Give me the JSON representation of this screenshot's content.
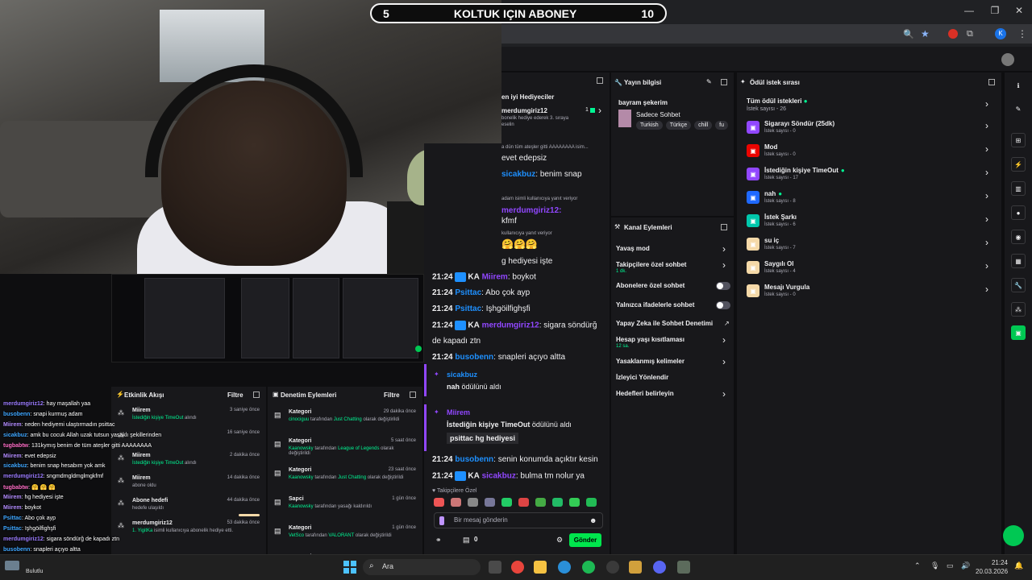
{
  "banner": {
    "left": "5",
    "title": "KOLTUK IÇIN ABONEY",
    "right": "10"
  },
  "browser": {
    "avatar_letter": "K"
  },
  "top_gifters": {
    "title": "en iyi Hediyeciler",
    "name": "merdumgiriz12",
    "count": "1",
    "desc1": "bonelik hediye ederek 3. sıraya",
    "desc2": "eselin"
  },
  "chat": {
    "lines_top": [
      {
        "text": "a dün tüm ateşler gitti AAAAAAAA isim...",
        "kind": "reply"
      },
      {
        "text": "evet edepsiz",
        "kind": "msg"
      },
      {
        "user": "sicakbuz",
        "text": "benim snap",
        "kind": "userline"
      },
      {
        "text": "adam isimli kullanıcıya yanıt veriyor",
        "kind": "reply"
      },
      {
        "user": "merdumgiriz12:",
        "text": "",
        "kind": "userline"
      },
      {
        "text": "kfmf",
        "kind": "msg"
      },
      {
        "text": "kullanıcıya yanıt veriyor",
        "kind": "reply"
      },
      {
        "text": "🤗🤗🤗",
        "kind": "msg"
      },
      {
        "text": "g hediyesi işte",
        "kind": "msg"
      }
    ],
    "lines": [
      {
        "time": "21:24",
        "badge": "KA",
        "user": "Miirem",
        "color": "#9147ff",
        "text": "boykot"
      },
      {
        "time": "21:24",
        "badge": "",
        "user": "Psittac",
        "color": "#1e90ff",
        "text": "Abo çok ayp"
      },
      {
        "time": "21:24",
        "badge": "",
        "user": "Psittac",
        "color": "#1e90ff",
        "text": "Işhgöilfighşfi"
      },
      {
        "time": "21:24",
        "badge": "KA",
        "user": "merdumgiriz12",
        "color": "#9147ff",
        "text": "sigara söndürğ"
      },
      {
        "time": "",
        "badge": "",
        "user": "",
        "color": "",
        "text": "de kapadı ztn"
      },
      {
        "time": "21:24",
        "badge": "",
        "user": "busobenn",
        "color": "#1e90ff",
        "text": "snapleri açıyo altta"
      }
    ],
    "redeem1": {
      "user": "sicakbuz",
      "reward": "nah",
      "suffix": "ödülünü aldı"
    },
    "redeem2": {
      "user": "Miirem",
      "reward": "İstediğin kişiye TimeOut",
      "suffix": "ödülünü aldı",
      "input": "psittac hg hediyesi"
    },
    "lines_after": [
      {
        "time": "21:24",
        "badge": "",
        "user": "busobenn",
        "color": "#1e90ff",
        "text": "senin konumda açıktır kesin"
      },
      {
        "time": "21:24",
        "badge": "KA",
        "user": "sicakbuz",
        "color": "#9147ff",
        "text": "bulma tm nolur ya"
      }
    ],
    "followers_only": "Takipçilere Özel",
    "input_placeholder": "Bir mesaj gönderin",
    "points": "0",
    "send": "Gönder"
  },
  "stream_info": {
    "title": "Yayın bilgisi",
    "stream_title": "bayram şekerim",
    "category": "Sadece Sohbet",
    "tags": [
      "Turkish",
      "Türkçe",
      "chill",
      "fu"
    ]
  },
  "channel_actions": {
    "title": "Kanal Eylemleri",
    "items": [
      {
        "label": "Yavaş mod",
        "sub": "",
        "control": "chevron"
      },
      {
        "label": "Takipçilere özel sohbet",
        "sub": "1 dk.",
        "control": "chevron"
      },
      {
        "label": "Abonelere özel sohbet",
        "sub": "",
        "control": "toggle"
      },
      {
        "label": "Yalnızca ifadelerle sohbet",
        "sub": "",
        "control": "toggle"
      },
      {
        "label": "Yapay Zeka ile Sohbet Denetimi",
        "sub": "",
        "control": "external"
      },
      {
        "label": "Hesap yaşı kısıtlaması",
        "sub": "12 sa.",
        "control": "chevron"
      },
      {
        "label": "Yasaklanmış kelimeler",
        "sub": "",
        "control": "chevron"
      },
      {
        "label": "İzleyici Yönlendir",
        "sub": "",
        "control": "none"
      },
      {
        "label": "Hedefleri belirleyin",
        "sub": "",
        "control": "chevron"
      }
    ]
  },
  "rewards": {
    "title": "Ödül istek sırası",
    "all": {
      "label": "Tüm ödül istekleri",
      "count": "İstek sayısı - 26"
    },
    "items": [
      {
        "label": "Sigarayı Söndür (25dk)",
        "count": "İstek sayısı - 0",
        "color": "#9147ff",
        "dot": false
      },
      {
        "label": "Mod",
        "count": "İstek sayısı - 0",
        "color": "#eb0400",
        "dot": false
      },
      {
        "label": "İstediğin kişiye TimeOut",
        "count": "İstek sayısı - 17",
        "color": "#9147ff",
        "dot": true
      },
      {
        "label": "nah",
        "count": "İstek sayısı - 8",
        "color": "#1f69ff",
        "dot": true
      },
      {
        "label": "İstek Şarkı",
        "count": "İstek sayısı - 6",
        "color": "#00c7ac",
        "dot": false
      },
      {
        "label": "su iç",
        "count": "İstek sayısı - 7",
        "color": "#f5d9a8",
        "dot": false
      },
      {
        "label": "Saygılı Ol",
        "count": "İstek sayısı - 4",
        "color": "#f5d9a8",
        "dot": false
      },
      {
        "label": "Mesajı Vurgula",
        "count": "İstek sayısı - 0",
        "color": "#f5d9a8",
        "dot": false
      }
    ]
  },
  "activity": {
    "title": "Etkinlik Akışı",
    "filter": "Filtre",
    "items": [
      {
        "user": "Miirem",
        "text": "İstediğin kişiye TimeOut",
        "suffix": "alındı",
        "time": "3 saniye önce"
      },
      {
        "user": "",
        "text": "",
        "suffix": "",
        "time": "16 saniye önce"
      },
      {
        "user": "Miirem",
        "text": "İstediğin kişiye TimeOut",
        "suffix": "alındı",
        "time": "2 dakika önce"
      },
      {
        "user": "Miirem",
        "text": "",
        "suffix": "abone oldu",
        "time": "14 dakika önce"
      },
      {
        "user": "Abone hedefi",
        "text": "",
        "suffix": "hedefe ulaşıldı",
        "time": "44 dakika önce"
      },
      {
        "user": "merdumgiriz12",
        "text": "1. YigitKa",
        "suffix": "isimli kullanıcıya abonelik hediye etti.",
        "time": "53 dakika önce"
      }
    ]
  },
  "moderation": {
    "title": "Denetim Eylemleri",
    "filter": "Filtre",
    "items": [
      {
        "title": "Kategori",
        "user": "cinociguu",
        "mid": "tarafından",
        "target": "Just Chatting",
        "end": "olarak değiştirildi",
        "time": "29 dakika önce"
      },
      {
        "title": "Kategori",
        "user": "Kaanowsky",
        "mid": "tarafından",
        "target": "League of Legends",
        "end": "olarak değiştirildi",
        "time": "5 saat önce"
      },
      {
        "title": "Kategori",
        "user": "Kaanowsky",
        "mid": "tarafından",
        "target": "Just Chatting",
        "end": "olarak değiştirildi",
        "time": "23 saat önce"
      },
      {
        "title": "Sapci",
        "user": "Kaanowsky",
        "mid": "tarafından yasağı kaldırıldı",
        "target": "",
        "end": "",
        "time": "1 gün önce"
      },
      {
        "title": "Kategori",
        "user": "VetSco",
        "mid": "tarafından",
        "target": "VALORANT",
        "end": "olarak değiştirildi",
        "time": "1 gün önce"
      },
      {
        "title": "Kategori",
        "user": "",
        "mid": "",
        "target": "",
        "end": "",
        "time": ""
      }
    ]
  },
  "overlay_chat": [
    {
      "user": "merdumgiriz12",
      "ucolor": "#9b7bff",
      "text": ": hay maşallah yaa"
    },
    {
      "user": "busobenn",
      "ucolor": "#3ea6ff",
      "text": ": snapi kurmuş adam"
    },
    {
      "user": "Miirem",
      "ucolor": "#b38cff",
      "text": ": neden hediyemi ulaştırmadın psittac"
    },
    {
      "user": "sicakbuz",
      "ucolor": "#3ea6ff",
      "text": ": amk bu cocuk Allah uzak tutsun yasaklı şekillerinden"
    },
    {
      "user": "tugbabtw",
      "ucolor": "#ff6ec7",
      "text": ": 131kymış benim de tüm ateşler gitti AAAAAAAA"
    },
    {
      "user": "Miirem",
      "ucolor": "#b38cff",
      "text": ": evet edepsiz"
    },
    {
      "user": "sicakbuz",
      "ucolor": "#3ea6ff",
      "text": ": benim snap hesabım yok amk"
    },
    {
      "user": "merdumgiriz12",
      "ucolor": "#9b7bff",
      "text": ": sngmdmgldmglmgkfmf"
    },
    {
      "user": "tugbabtw",
      "ucolor": "#ff6ec7",
      "text": ": 🤗 🤗 🤗"
    },
    {
      "user": "Miirem",
      "ucolor": "#b38cff",
      "text": ": hg hediyesi işte"
    },
    {
      "user": "Miirem",
      "ucolor": "#b38cff",
      "text": ": boykot"
    },
    {
      "user": "Psittac",
      "ucolor": "#3ea6ff",
      "text": ": Abo çok ayp"
    },
    {
      "user": "Psittac",
      "ucolor": "#3ea6ff",
      "text": ": Işhgöilfighşfi"
    },
    {
      "user": "merdumgiriz12",
      "ucolor": "#9b7bff",
      "text": ": sigara söndürğ de kapadı ztn"
    },
    {
      "user": "busobenn",
      "ucolor": "#3ea6ff",
      "text": ": snapleri açıyo altta"
    },
    {
      "user": "busobenn",
      "ucolor": "#3ea6ff",
      "text": ": senin konumda açıktır kesin"
    },
    {
      "user": "sicakbuz",
      "ucolor": "#3ea6ff",
      "text": ": bulma tm nolur ya"
    }
  ],
  "taskbar": {
    "search": "Ara",
    "time": "21:24",
    "date": "20.03.2026",
    "weather": "Bulutlu"
  }
}
